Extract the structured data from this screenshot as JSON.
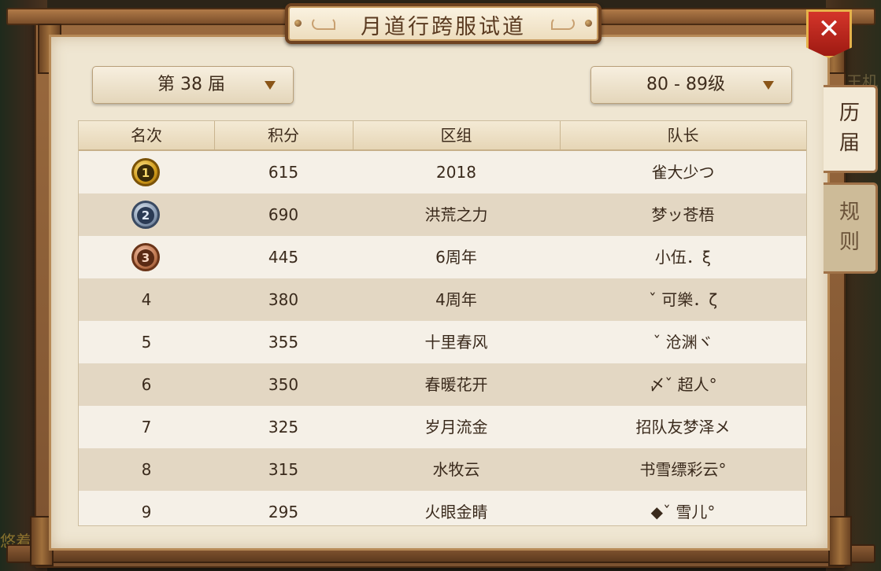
{
  "window": {
    "title": "月道行跨服试道",
    "close_icon": "✕"
  },
  "background": {
    "left_text": "悠着",
    "right_text": "王机"
  },
  "filters": {
    "season_selected": "第 38 届",
    "level_selected": "80 - 89级"
  },
  "side_tabs": {
    "history": [
      "历",
      "届"
    ],
    "rules": [
      "规",
      "则"
    ],
    "active": "history"
  },
  "table": {
    "headers": [
      "名次",
      "积分",
      "区组",
      "队长"
    ],
    "rows": [
      {
        "rank": "1",
        "medal": "gold-medal-icon",
        "score": "615",
        "server": "2018",
        "captain": "雀大少つ"
      },
      {
        "rank": "2",
        "medal": "silver-medal-icon",
        "score": "690",
        "server": "洪荒之力",
        "captain": "梦ッ苍梧"
      },
      {
        "rank": "3",
        "medal": "bronze-medal-icon",
        "score": "445",
        "server": "6周年",
        "captain": "小伍．ξ"
      },
      {
        "rank": "4",
        "score": "380",
        "server": "4周年",
        "captain": "ˇ 可樂．ζ"
      },
      {
        "rank": "5",
        "score": "355",
        "server": "十里春风",
        "captain": "ˇ 沧渊ヾ"
      },
      {
        "rank": "6",
        "score": "350",
        "server": "春暖花开",
        "captain": "〆ˇ 超人°"
      },
      {
        "rank": "7",
        "score": "325",
        "server": "岁月流金",
        "captain": "招队友梦泽メ"
      },
      {
        "rank": "8",
        "score": "315",
        "server": "水牧云",
        "captain": "书雪缥彩云°"
      },
      {
        "rank": "9",
        "score": "295",
        "server": "火眼金睛",
        "captain": "◆ˇ 雪儿°"
      }
    ]
  },
  "colors": {
    "parchment": "#efe6d2",
    "frame_wood": "#8a5a34",
    "close_red": "#c42a20",
    "row_dark": "#e3d7c3",
    "row_light": "#f5f0e7"
  }
}
